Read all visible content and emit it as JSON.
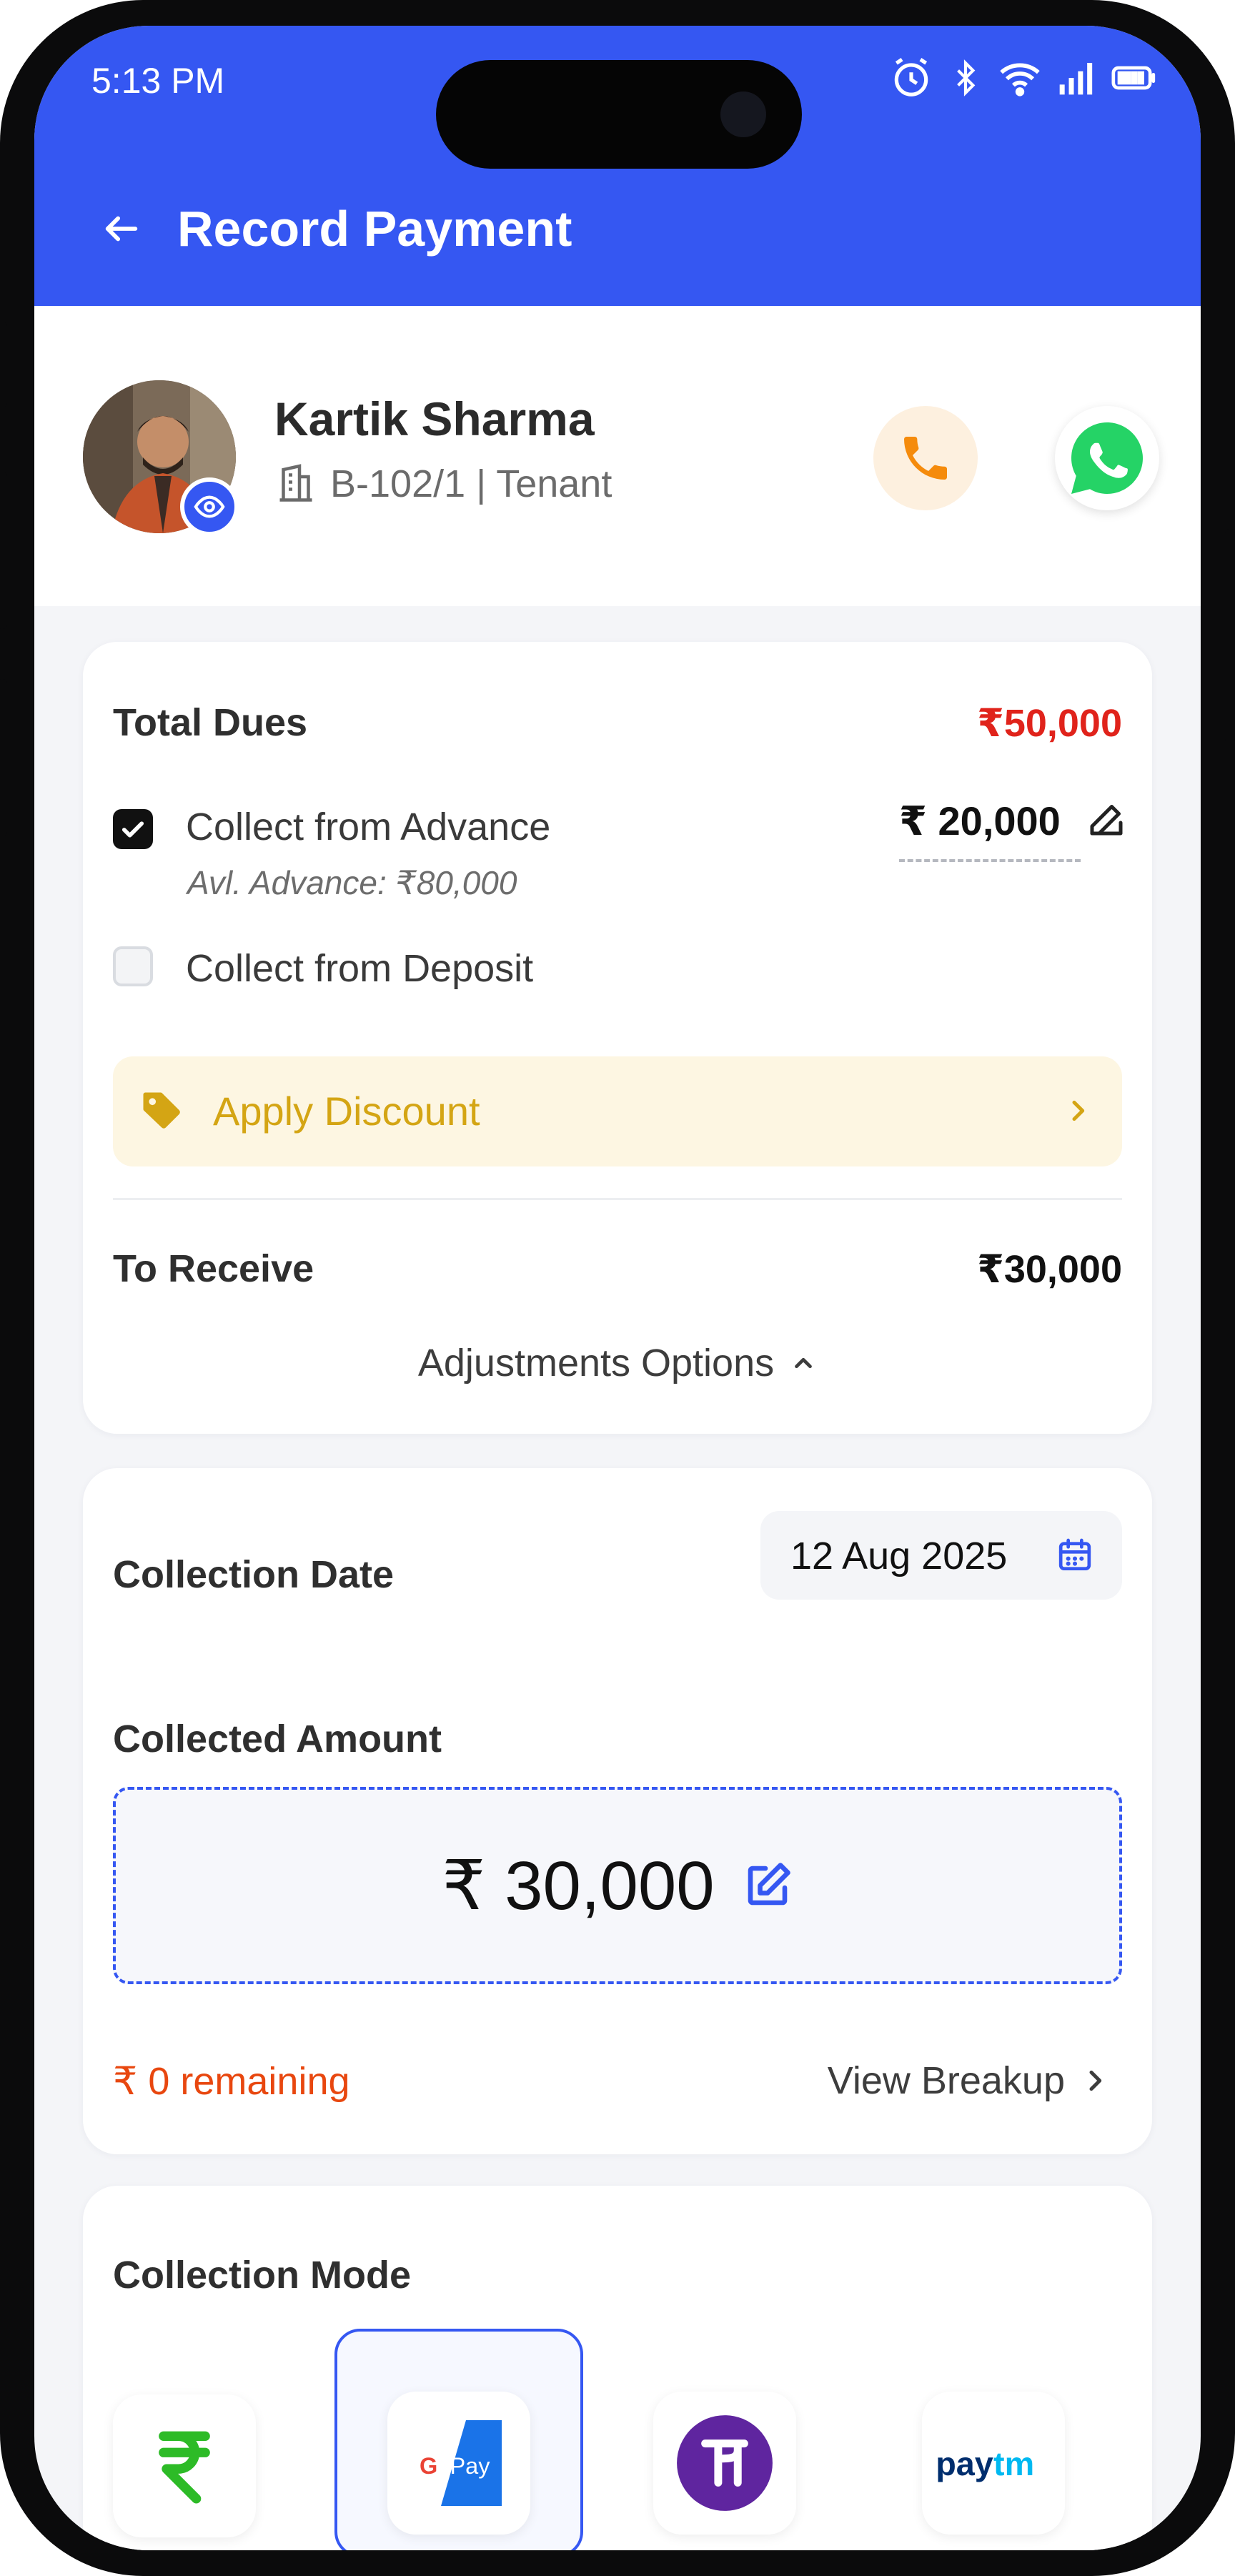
{
  "status_bar": {
    "time": "5:13 PM"
  },
  "header": {
    "title": "Record Payment"
  },
  "tenant": {
    "name": "Kartik Sharma",
    "unit": "B-102/1 | Tenant"
  },
  "dues": {
    "total_label": "Total Dues",
    "total_value": "₹50,000",
    "advance_label": "Collect from Advance",
    "advance_checked": true,
    "advance_available": "Avl. Advance: ₹80,000",
    "advance_amount": "₹ 20,000",
    "deposit_label": "Collect from Deposit",
    "deposit_checked": false,
    "discount_label": "Apply Discount",
    "receive_label": "To Receive",
    "receive_value": "₹30,000",
    "adjustments_label": "Adjustments Options"
  },
  "collection": {
    "date_label": "Collection Date",
    "date_value": "12 Aug 2025",
    "amount_label": "Collected Amount",
    "amount_value": "₹ 30,000",
    "remaining": "₹ 0 remaining",
    "breakup_label": "View Breakup"
  },
  "mode": {
    "title": "Collection Mode",
    "options": [
      {
        "id": "cash",
        "icon": "rupee-icon"
      },
      {
        "id": "gpay",
        "icon": "google-pay-icon",
        "selected": true
      },
      {
        "id": "phonepe",
        "icon": "phonepe-icon"
      },
      {
        "id": "paytm",
        "icon": "paytm-icon"
      }
    ]
  },
  "colors": {
    "primary": "#3557f2",
    "due_red": "#e0231b",
    "remaining_orange": "#e8470f",
    "discount_gold": "#d4a514",
    "call_orange": "#f58b0c",
    "whatsapp_green": "#25d366"
  }
}
